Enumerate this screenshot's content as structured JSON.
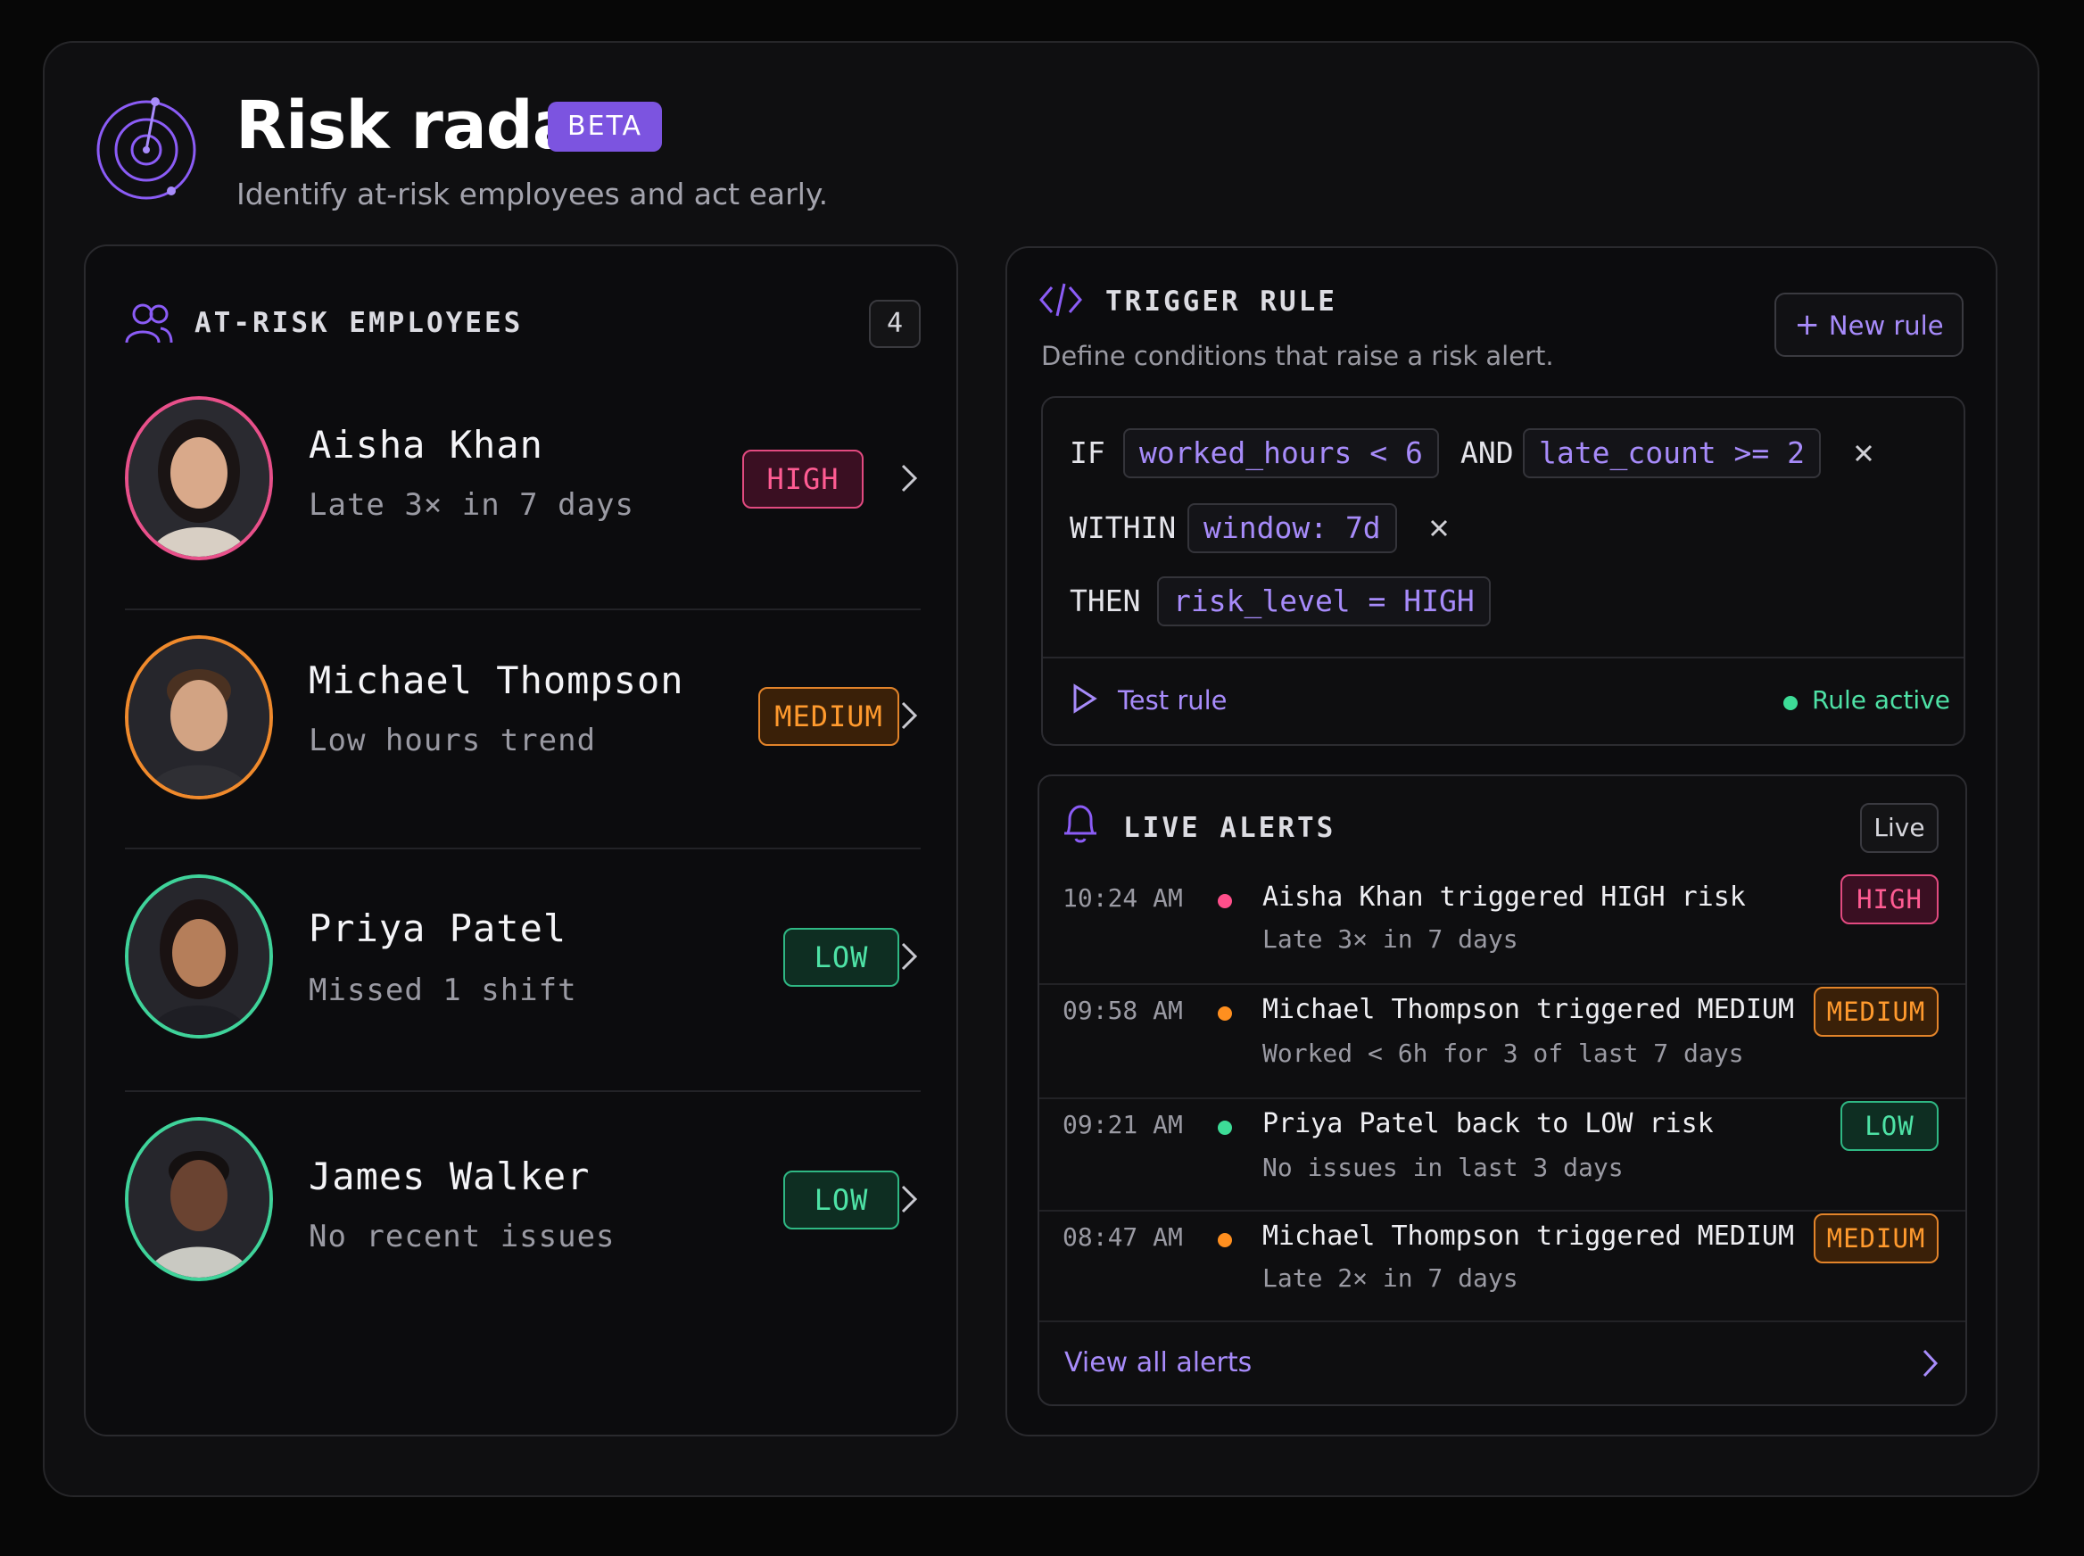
{
  "header": {
    "title": "Risk radar",
    "badge": "BETA",
    "subtitle": "Identify at-risk employees and act early."
  },
  "employees_panel": {
    "title": "AT-RISK EMPLOYEES",
    "count": "4",
    "items": [
      {
        "name": "Aisha Khan",
        "reason": "Late 3× in 7 days",
        "risk": "HIGH",
        "ring": "#e8508a"
      },
      {
        "name": "Michael Thompson",
        "reason": "Low hours trend",
        "risk": "MEDIUM",
        "ring": "#f08a2c"
      },
      {
        "name": "Priya Patel",
        "reason": "Missed 1 shift",
        "risk": "LOW",
        "ring": "#3fd39a"
      },
      {
        "name": "James Walker",
        "reason": "No recent issues",
        "risk": "LOW",
        "ring": "#3fd39a"
      }
    ]
  },
  "trigger_rule": {
    "title": "TRIGGER RULE",
    "description": "Define conditions that raise a risk alert.",
    "new_rule_label": "New rule",
    "kw_if": "IF",
    "cond1": "worked_hours < 6",
    "kw_and": "AND",
    "cond2": "late_count >= 2",
    "kw_within": "WITHIN",
    "window": "window: 7d",
    "kw_then": "THEN",
    "action": "risk_level = HIGH",
    "test_label": "Test rule",
    "status_label": "Rule active"
  },
  "live_alerts": {
    "title": "LIVE ALERTS",
    "pill": "Live",
    "items": [
      {
        "time": "10:24 AM",
        "message": "Aisha Khan triggered HIGH risk",
        "detail": "Late 3× in 7 days",
        "risk": "HIGH",
        "dot": "#ff4f8b"
      },
      {
        "time": "09:58 AM",
        "message": "Michael Thompson triggered MEDIUM risk",
        "detail": "Worked < 6h for 3 of last 7 days",
        "risk": "MEDIUM",
        "dot": "#ff8f1f"
      },
      {
        "time": "09:21 AM",
        "message": "Priya Patel back to LOW risk",
        "detail": "No issues in last 3 days",
        "risk": "LOW",
        "dot": "#3ddc97"
      },
      {
        "time": "08:47 AM",
        "message": "Michael Thompson triggered MEDIUM risk",
        "detail": "Late 2× in 7 days",
        "risk": "MEDIUM",
        "dot": "#ff8f1f"
      }
    ],
    "view_all": "View all alerts"
  },
  "colors": {
    "accent": "#7c54e0",
    "high": "#ff5c93",
    "medium": "#ff9a2e",
    "low": "#4ee2a6"
  }
}
